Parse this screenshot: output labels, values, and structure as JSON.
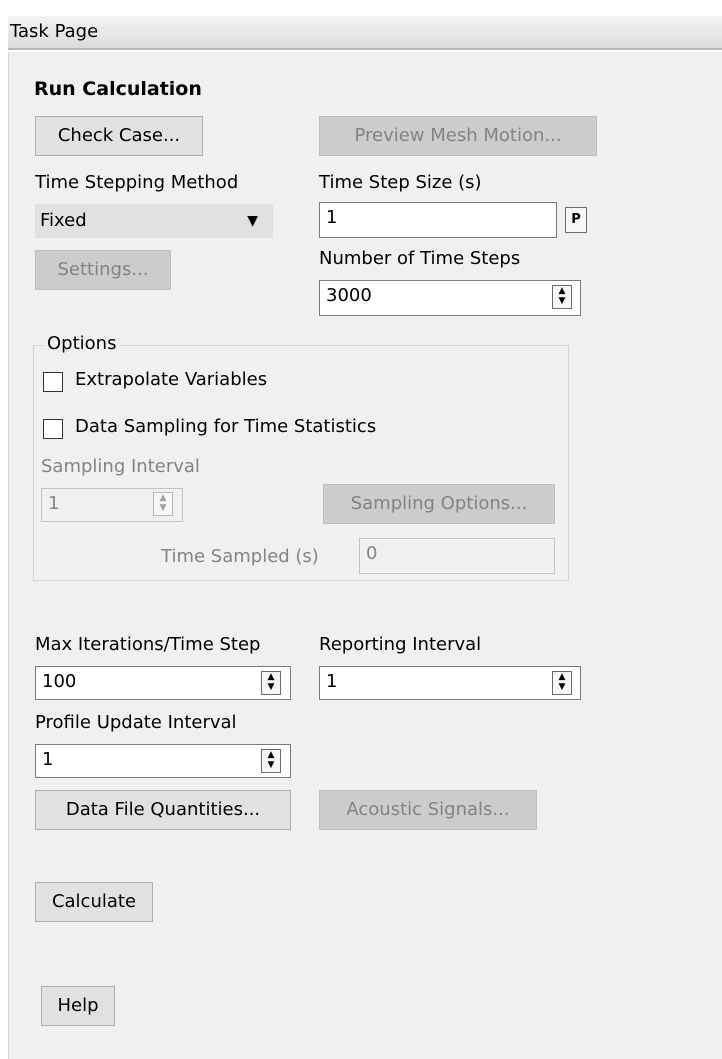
{
  "titlebar": {
    "title": "Task Page"
  },
  "run": {
    "heading": "Run Calculation",
    "check_case_label": "Check Case...",
    "preview_mesh_motion_label": "Preview Mesh Motion...",
    "time_stepping_method_label": "Time Stepping Method",
    "time_stepping_method_value": "Fixed",
    "settings_label": "Settings...",
    "time_step_size_label": "Time Step Size (s)",
    "time_step_size_value": "1",
    "p_button_label": "P",
    "number_of_time_steps_label": "Number of Time Steps",
    "number_of_time_steps_value": "3000"
  },
  "options": {
    "legend": "Options",
    "extrapolate_label": "Extrapolate Variables",
    "data_sampling_label": "Data Sampling for Time Statistics",
    "sampling_interval_label": "Sampling Interval",
    "sampling_interval_value": "1",
    "sampling_options_label": "Sampling Options...",
    "time_sampled_label": "Time Sampled (s)",
    "time_sampled_value": "0"
  },
  "iteration": {
    "max_iterations_label": "Max Iterations/Time Step",
    "max_iterations_value": "100",
    "reporting_interval_label": "Reporting Interval",
    "reporting_interval_value": "1",
    "profile_update_label": "Profile Update Interval",
    "profile_update_value": "1",
    "data_file_quantities_label": "Data File Quantities...",
    "acoustic_signals_label": "Acoustic Signals..."
  },
  "actions": {
    "calculate_label": "Calculate",
    "help_label": "Help"
  },
  "icons": {
    "dropdown_arrow": "▼",
    "spin_up": "▲",
    "spin_down": "▼"
  }
}
